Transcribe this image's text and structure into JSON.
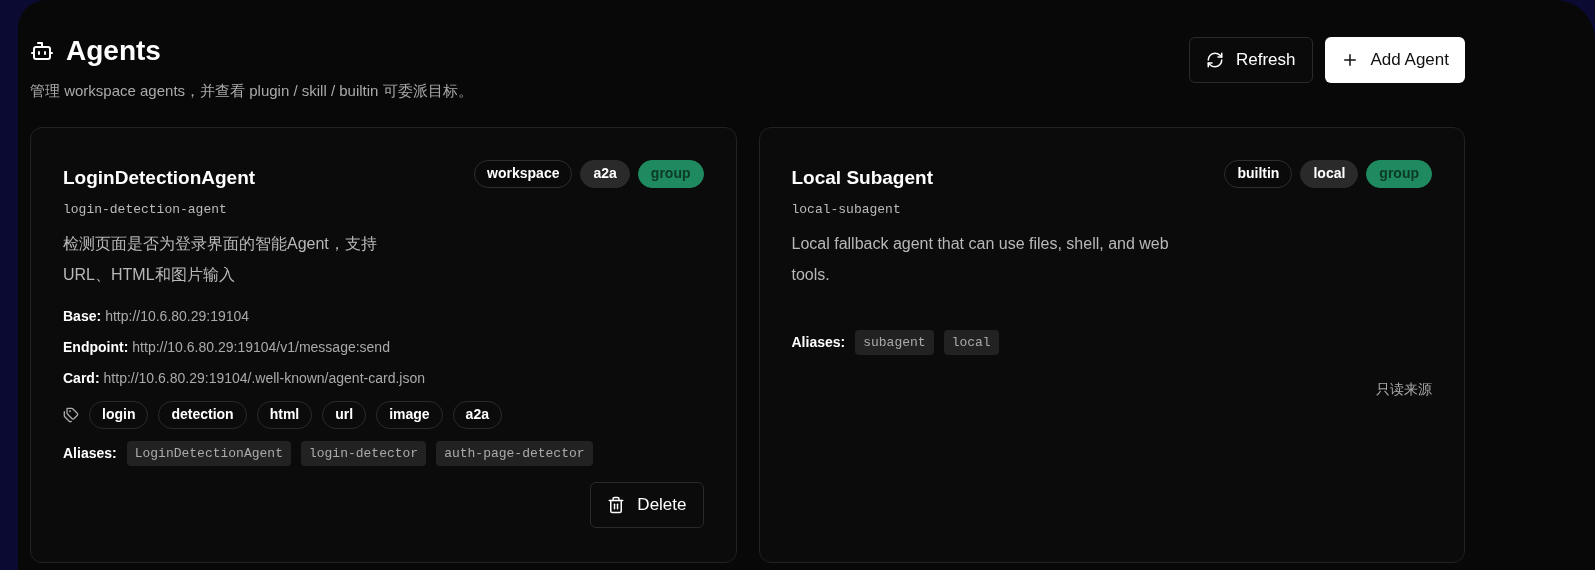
{
  "header": {
    "title": "Agents",
    "subtitle": "管理 workspace agents，并查看 plugin / skill / builtin 可委派目标。",
    "buttons": [
      {
        "kind": "outline",
        "label": "Refresh"
      },
      {
        "kind": "primary",
        "label": "Add Agent"
      }
    ]
  },
  "agents": [
    {
      "name": "LoginDetectionAgent",
      "id": "login-detection-agent",
      "badges": [
        {
          "kind": "outline",
          "label": "workspace"
        },
        {
          "kind": "filled",
          "label": "a2a"
        },
        {
          "kind": "group",
          "label": "group"
        }
      ],
      "description": "检测页面是否为登录界面的智能Agent，支持URL、HTML和图片输入",
      "fields": [
        {
          "label": "Base:",
          "value": "http://10.6.80.29:19104"
        },
        {
          "label": "Endpoint:",
          "value": "http://10.6.80.29:19104/v1/message:send"
        },
        {
          "label": "Card:",
          "value": "http://10.6.80.29:19104/.well-known/agent-card.json"
        }
      ],
      "tags": [
        "login",
        "detection",
        "html",
        "url",
        "image",
        "a2a"
      ],
      "aliases_label": "Aliases:",
      "aliases": [
        "LoginDetectionAgent",
        "login-detector",
        "auth-page-detector"
      ],
      "action": {
        "kind": "delete",
        "label": "Delete"
      }
    },
    {
      "name": "Local Subagent",
      "id": "local-subagent",
      "badges": [
        {
          "kind": "outline",
          "label": "builtin"
        },
        {
          "kind": "filled",
          "label": "local"
        },
        {
          "kind": "group",
          "label": "group"
        }
      ],
      "description": "Local fallback agent that can use files, shell, and web tools.",
      "aliases_label": "Aliases:",
      "aliases": [
        "subagent",
        "local"
      ],
      "action": {
        "kind": "readonly",
        "label": "只读来源"
      }
    }
  ]
}
